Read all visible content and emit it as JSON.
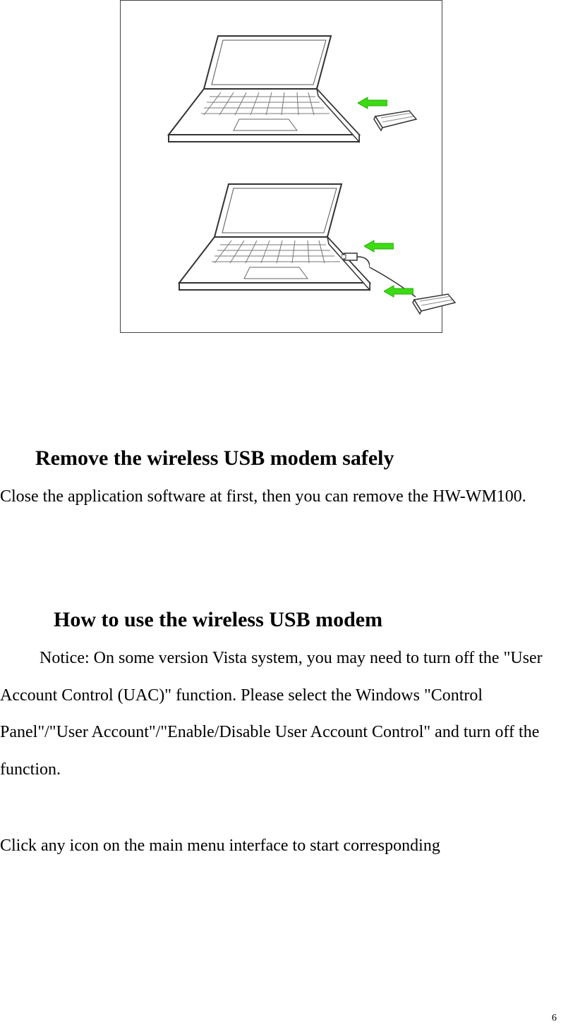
{
  "diagram": {
    "label_top": "laptop-with-modem-direct-insert-illustration",
    "label_bottom": "laptop-with-modem-via-cable-illustration",
    "arrow_color": "#3bdc12"
  },
  "headings": {
    "remove": "Remove the wireless USB modem safely",
    "howto": "How to use the wireless USB modem"
  },
  "paragraphs": {
    "remove_body": "Close the application software at first, then you can remove the HW-WM100.",
    "howto_notice": "Notice: On some version Vista system, you may need to turn off the \"User Account Control (UAC)\" function. Please select the Windows \"Control Panel\"/\"User Account\"/\"Enable/Disable User Account Control\" and turn off the function.",
    "howto_click": "Click any icon on the main menu interface to start corresponding"
  },
  "page_number": "6"
}
